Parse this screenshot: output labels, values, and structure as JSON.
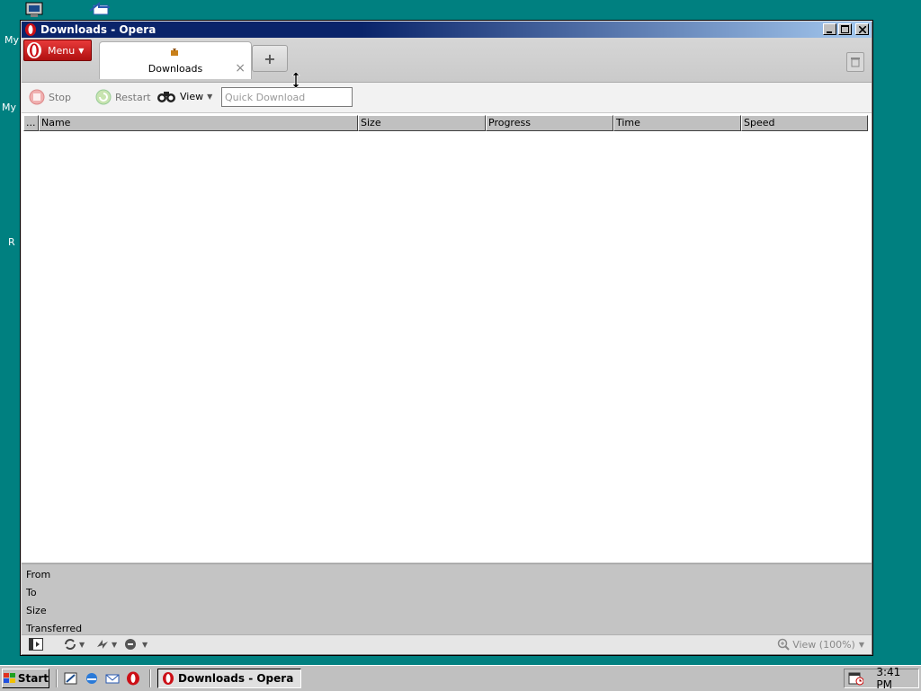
{
  "desktop": {
    "labels": [
      "My",
      "My",
      "R"
    ]
  },
  "window": {
    "title": "Downloads - Opera",
    "controls": [
      "minimize",
      "maximize",
      "close"
    ]
  },
  "tabbar": {
    "menu_label": "Menu",
    "tab_title": "Downloads",
    "new_tab_symbol": "+",
    "close_symbol": "×"
  },
  "toolbar": {
    "stop_label": "Stop",
    "restart_label": "Restart",
    "view_label": "View",
    "quick_download_placeholder": "Quick Download"
  },
  "list": {
    "columns": [
      "...",
      "Name",
      "Size",
      "Progress",
      "Time",
      "Speed"
    ],
    "rows": []
  },
  "details": {
    "from_label": "From",
    "to_label": "To",
    "size_label": "Size",
    "transferred_label": "Transferred"
  },
  "statusbar": {
    "zoom_label": "View (100%)"
  },
  "taskbar": {
    "start_label": "Start",
    "task_label": "Downloads - Opera",
    "clock": "3:41 PM"
  },
  "colors": {
    "desktop": "#008080",
    "titlebar": "#0a246a",
    "opera_red": "#cc0f16"
  }
}
